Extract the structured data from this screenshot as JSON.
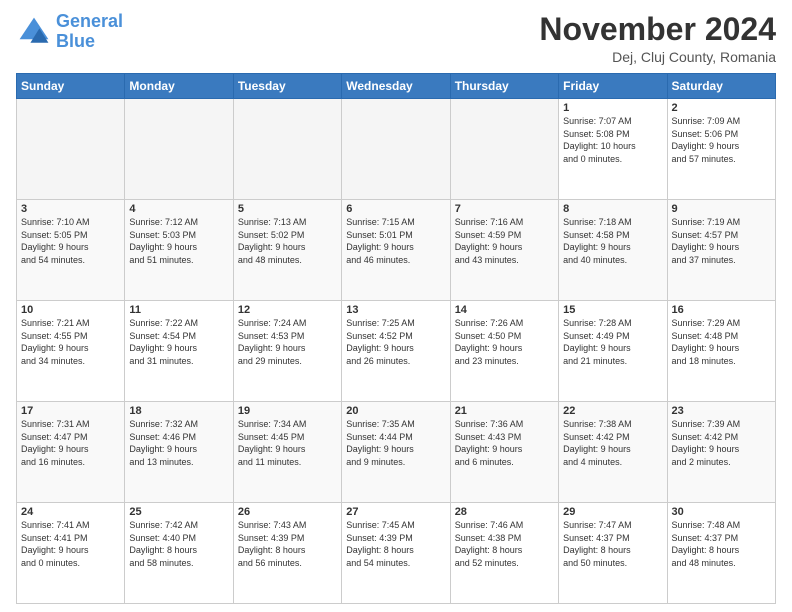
{
  "logo": {
    "line1": "General",
    "line2": "Blue"
  },
  "title": "November 2024",
  "subtitle": "Dej, Cluj County, Romania",
  "weekdays": [
    "Sunday",
    "Monday",
    "Tuesday",
    "Wednesday",
    "Thursday",
    "Friday",
    "Saturday"
  ],
  "weeks": [
    [
      {
        "day": "",
        "info": ""
      },
      {
        "day": "",
        "info": ""
      },
      {
        "day": "",
        "info": ""
      },
      {
        "day": "",
        "info": ""
      },
      {
        "day": "",
        "info": ""
      },
      {
        "day": "1",
        "info": "Sunrise: 7:07 AM\nSunset: 5:08 PM\nDaylight: 10 hours\nand 0 minutes."
      },
      {
        "day": "2",
        "info": "Sunrise: 7:09 AM\nSunset: 5:06 PM\nDaylight: 9 hours\nand 57 minutes."
      }
    ],
    [
      {
        "day": "3",
        "info": "Sunrise: 7:10 AM\nSunset: 5:05 PM\nDaylight: 9 hours\nand 54 minutes."
      },
      {
        "day": "4",
        "info": "Sunrise: 7:12 AM\nSunset: 5:03 PM\nDaylight: 9 hours\nand 51 minutes."
      },
      {
        "day": "5",
        "info": "Sunrise: 7:13 AM\nSunset: 5:02 PM\nDaylight: 9 hours\nand 48 minutes."
      },
      {
        "day": "6",
        "info": "Sunrise: 7:15 AM\nSunset: 5:01 PM\nDaylight: 9 hours\nand 46 minutes."
      },
      {
        "day": "7",
        "info": "Sunrise: 7:16 AM\nSunset: 4:59 PM\nDaylight: 9 hours\nand 43 minutes."
      },
      {
        "day": "8",
        "info": "Sunrise: 7:18 AM\nSunset: 4:58 PM\nDaylight: 9 hours\nand 40 minutes."
      },
      {
        "day": "9",
        "info": "Sunrise: 7:19 AM\nSunset: 4:57 PM\nDaylight: 9 hours\nand 37 minutes."
      }
    ],
    [
      {
        "day": "10",
        "info": "Sunrise: 7:21 AM\nSunset: 4:55 PM\nDaylight: 9 hours\nand 34 minutes."
      },
      {
        "day": "11",
        "info": "Sunrise: 7:22 AM\nSunset: 4:54 PM\nDaylight: 9 hours\nand 31 minutes."
      },
      {
        "day": "12",
        "info": "Sunrise: 7:24 AM\nSunset: 4:53 PM\nDaylight: 9 hours\nand 29 minutes."
      },
      {
        "day": "13",
        "info": "Sunrise: 7:25 AM\nSunset: 4:52 PM\nDaylight: 9 hours\nand 26 minutes."
      },
      {
        "day": "14",
        "info": "Sunrise: 7:26 AM\nSunset: 4:50 PM\nDaylight: 9 hours\nand 23 minutes."
      },
      {
        "day": "15",
        "info": "Sunrise: 7:28 AM\nSunset: 4:49 PM\nDaylight: 9 hours\nand 21 minutes."
      },
      {
        "day": "16",
        "info": "Sunrise: 7:29 AM\nSunset: 4:48 PM\nDaylight: 9 hours\nand 18 minutes."
      }
    ],
    [
      {
        "day": "17",
        "info": "Sunrise: 7:31 AM\nSunset: 4:47 PM\nDaylight: 9 hours\nand 16 minutes."
      },
      {
        "day": "18",
        "info": "Sunrise: 7:32 AM\nSunset: 4:46 PM\nDaylight: 9 hours\nand 13 minutes."
      },
      {
        "day": "19",
        "info": "Sunrise: 7:34 AM\nSunset: 4:45 PM\nDaylight: 9 hours\nand 11 minutes."
      },
      {
        "day": "20",
        "info": "Sunrise: 7:35 AM\nSunset: 4:44 PM\nDaylight: 9 hours\nand 9 minutes."
      },
      {
        "day": "21",
        "info": "Sunrise: 7:36 AM\nSunset: 4:43 PM\nDaylight: 9 hours\nand 6 minutes."
      },
      {
        "day": "22",
        "info": "Sunrise: 7:38 AM\nSunset: 4:42 PM\nDaylight: 9 hours\nand 4 minutes."
      },
      {
        "day": "23",
        "info": "Sunrise: 7:39 AM\nSunset: 4:42 PM\nDaylight: 9 hours\nand 2 minutes."
      }
    ],
    [
      {
        "day": "24",
        "info": "Sunrise: 7:41 AM\nSunset: 4:41 PM\nDaylight: 9 hours\nand 0 minutes."
      },
      {
        "day": "25",
        "info": "Sunrise: 7:42 AM\nSunset: 4:40 PM\nDaylight: 8 hours\nand 58 minutes."
      },
      {
        "day": "26",
        "info": "Sunrise: 7:43 AM\nSunset: 4:39 PM\nDaylight: 8 hours\nand 56 minutes."
      },
      {
        "day": "27",
        "info": "Sunrise: 7:45 AM\nSunset: 4:39 PM\nDaylight: 8 hours\nand 54 minutes."
      },
      {
        "day": "28",
        "info": "Sunrise: 7:46 AM\nSunset: 4:38 PM\nDaylight: 8 hours\nand 52 minutes."
      },
      {
        "day": "29",
        "info": "Sunrise: 7:47 AM\nSunset: 4:37 PM\nDaylight: 8 hours\nand 50 minutes."
      },
      {
        "day": "30",
        "info": "Sunrise: 7:48 AM\nSunset: 4:37 PM\nDaylight: 8 hours\nand 48 minutes."
      }
    ]
  ]
}
